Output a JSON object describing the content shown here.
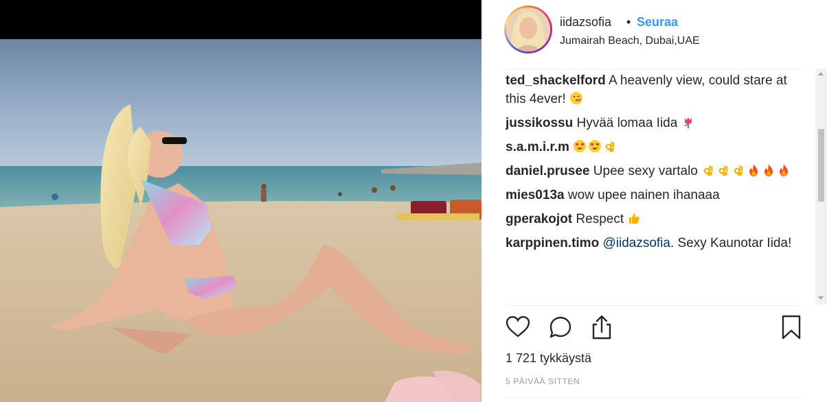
{
  "post": {
    "username": "iidazsofia",
    "separator": "•",
    "follow_label": "Seuraa",
    "location": "Jumairah Beach, Dubai,UAE",
    "likes": "1 721 tykkäystä",
    "posted": "5 PÄIVÄÄ SITTEN"
  },
  "comments": [
    {
      "user": "ted_shackelford",
      "text": "A heavenly view, could stare at this 4ever!",
      "emojis": [
        "kissing-face"
      ]
    },
    {
      "user": "jussikossu",
      "text": "Hyvää lomaa Iida",
      "emojis": [
        "tulip"
      ]
    },
    {
      "user": "s.a.m.i.r.m",
      "text": "",
      "emojis": [
        "heart-eyes",
        "heart-eyes",
        "ok-hand"
      ]
    },
    {
      "user": "daniel.prusee",
      "text": "Upee sexy vartalo",
      "emojis": [
        "ok-hand",
        "ok-hand",
        "ok-hand",
        "fire",
        "fire",
        "fire"
      ]
    },
    {
      "user": "mies013a",
      "text": "wow upee nainen ihanaaa",
      "emojis": []
    },
    {
      "user": "gperakojot",
      "text": "Respect",
      "emojis": [
        "thumbs-up"
      ]
    },
    {
      "user": "karppinen.timo",
      "mention": "@iidazsofia",
      "text": ". Sexy Kaunotar Iida!",
      "emojis": []
    }
  ],
  "icons": {
    "like": "heart-icon",
    "comment": "comment-bubble-icon",
    "share": "share-icon",
    "save": "bookmark-icon"
  },
  "colors": {
    "follow": "#3897f0",
    "mention": "#003569",
    "muted": "#999999"
  }
}
